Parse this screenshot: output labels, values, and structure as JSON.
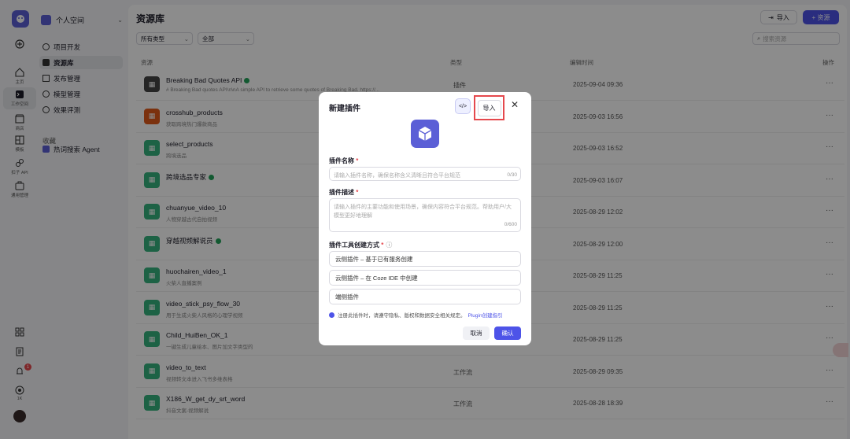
{
  "rail": {
    "items": [
      {
        "label": "主页"
      },
      {
        "label": "工作空间"
      },
      {
        "label": "商店"
      },
      {
        "label": "模板"
      },
      {
        "label": "扣子 API"
      },
      {
        "label": "通用管理"
      }
    ],
    "notification_count": "1",
    "points_label": "1K"
  },
  "panel": {
    "space_name": "个人空间",
    "nav": [
      {
        "label": "项目开发"
      },
      {
        "label": "资源库"
      },
      {
        "label": "发布管理"
      },
      {
        "label": "模型管理"
      },
      {
        "label": "效果评测"
      }
    ],
    "favorites_label": "收藏",
    "favorites": [
      {
        "label": "热词搜索 Agent"
      }
    ]
  },
  "main": {
    "title": "资源库",
    "import_label": "导入",
    "add_label": "+ 资源",
    "filter_type": "所有类型",
    "filter_scope": "全部",
    "search_placeholder": "搜索资源",
    "columns": {
      "resource": "资源",
      "type": "类型",
      "edited": "编辑时间",
      "actions": "操作"
    },
    "rows": [
      {
        "name": "Breaking Bad Quotes API",
        "desc": "# Breaking Bad quotes API\\n\\nA simple API to retrieve some quotes of Breaking Bad. https://...",
        "type": "插件",
        "time": "2025-09-04 09:36",
        "verified": true
      },
      {
        "name": "crosshub_products",
        "desc": "获取跨境热门爆款商品",
        "type": "",
        "time": "2025-09-03 16:56",
        "verified": false
      },
      {
        "name": "select_products",
        "desc": "跨境选品",
        "type": "",
        "time": "2025-09-03 16:52",
        "verified": false
      },
      {
        "name": "跨境选品专家",
        "desc": "",
        "type": "",
        "time": "2025-09-03 16:07",
        "verified": true
      },
      {
        "name": "chuanyue_video_10",
        "desc": "人物穿越古代自拍视频",
        "type": "",
        "time": "2025-08-29 12:02",
        "verified": false
      },
      {
        "name": "穿越视频解说员",
        "desc": "",
        "type": "",
        "time": "2025-08-29 12:00",
        "verified": true
      },
      {
        "name": "huochairen_video_1",
        "desc": "火柴人直播案例",
        "type": "",
        "time": "2025-08-29 11:25",
        "verified": false
      },
      {
        "name": "video_stick_psy_flow_30",
        "desc": "用于生成火柴人风格的心理学视频",
        "type": "",
        "time": "2025-08-29 11:25",
        "verified": false
      },
      {
        "name": "Child_HuiBen_OK_1",
        "desc": "一键生成儿童绘本、图片加文字类型的",
        "type": "",
        "time": "2025-08-29 11:25",
        "verified": false
      },
      {
        "name": "video_to_text",
        "desc": "视频转文本进入飞书多维表格",
        "type": "工作流",
        "time": "2025-08-29 09:35",
        "verified": false
      },
      {
        "name": "X186_W_get_dy_srt_word",
        "desc": "抖音文案-视频解说",
        "type": "工作流",
        "time": "2025-08-28 18:39",
        "verified": false
      }
    ]
  },
  "modal": {
    "title": "新建插件",
    "code_label": "</>",
    "import_label": "导入",
    "name_label": "插件名称",
    "name_placeholder": "请输入插件名称，确保名称含义清晰且符合平台规范",
    "name_count": "0/30",
    "desc_label": "插件描述",
    "desc_placeholder": "请输入插件的主要功能和使用场景，确保内容符合平台规范。帮助用户/大模型更好地理解",
    "desc_count": "0/600",
    "method_label": "插件工具创建方式",
    "options": [
      {
        "label": "云侧插件 – 基于已有服务创建"
      },
      {
        "label": "云侧插件 – 在 Coze IDE 中创建"
      },
      {
        "label": "端侧插件"
      }
    ],
    "note": "注册此插件时，请遵守隐私、版权和数据安全相关规定。",
    "note_link": "Plugin创建指引",
    "cancel_label": "取消",
    "confirm_label": "确认"
  }
}
